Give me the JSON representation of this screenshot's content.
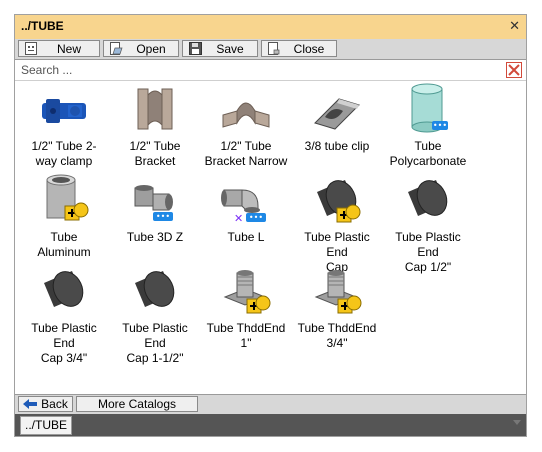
{
  "window": {
    "title": "../TUBE"
  },
  "toolbar": {
    "new_label": "New",
    "open_label": "Open",
    "save_label": "Save",
    "close_label": "Close"
  },
  "search": {
    "placeholder": "Search ..."
  },
  "items": [
    {
      "line1": "1/2\" Tube  2-",
      "line2": "way clamp",
      "icon": "blue-clamp-icon"
    },
    {
      "line1": "1/2\" Tube",
      "line2": "Bracket",
      "icon": "bracket-icon"
    },
    {
      "line1": "1/2\" Tube",
      "line2": "Bracket Narrow",
      "icon": "narrow-bracket-icon"
    },
    {
      "line1": "3/8 tube clip",
      "line2": "",
      "icon": "tube-clip-icon"
    },
    {
      "line1": "Tube",
      "line2": "Polycarbonate",
      "icon": "clear-tube-icon"
    },
    {
      "line1": "Tube",
      "line2": "Aluminum",
      "icon": "aluminum-tube-icon"
    },
    {
      "line1": "Tube 3D Z",
      "line2": "",
      "icon": "elbow-3dz-icon"
    },
    {
      "line1": "Tube L",
      "line2": "",
      "icon": "elbow-l-icon"
    },
    {
      "line1": "Tube Plastic End",
      "line2": "Cap",
      "icon": "end-cap-icon"
    },
    {
      "line1": "Tube Plastic End",
      "line2": "Cap 1/2\"",
      "icon": "end-cap-icon"
    },
    {
      "line1": "Tube Plastic End",
      "line2": "Cap 3/4\"",
      "icon": "end-cap-icon"
    },
    {
      "line1": "Tube Plastic End",
      "line2": "Cap 1-1/2\"",
      "icon": "end-cap-icon"
    },
    {
      "line1": "Tube ThddEnd",
      "line2": "1\"",
      "icon": "threaded-end-icon"
    },
    {
      "line1": "Tube ThddEnd",
      "line2": "3/4\"",
      "icon": "threaded-end-icon"
    }
  ],
  "bottombar": {
    "back_label": "Back",
    "more_label": "More Catalogs"
  },
  "pathbar": {
    "current": "../TUBE"
  },
  "colors": {
    "title_bar": "#f8d58e",
    "toolbar": "#d7d7d7",
    "path_bar": "#555555",
    "badge_blue": "#1e88e5",
    "badge_yellow": "#f5c518"
  }
}
